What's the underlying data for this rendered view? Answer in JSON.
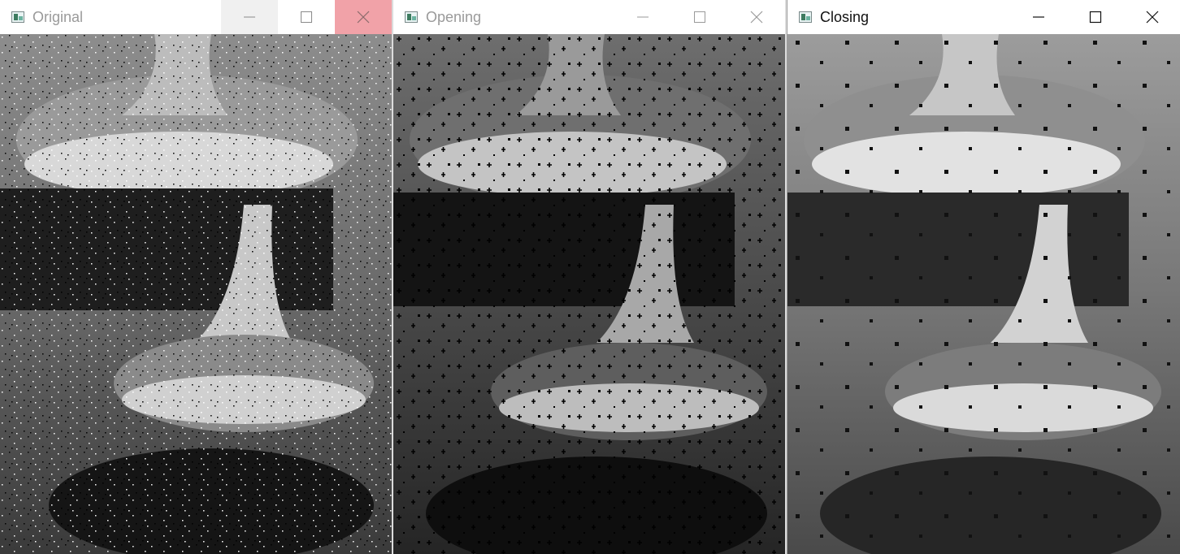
{
  "windows": [
    {
      "title": "Original",
      "state": "inactive",
      "close_hover": true
    },
    {
      "title": "Opening",
      "state": "inactive",
      "close_hover": false
    },
    {
      "title": "Closing",
      "state": "active",
      "close_hover": false
    }
  ],
  "colors": {
    "titlebar_bg": "#ffffff",
    "close_hover_bg": "#f1a2a8",
    "min_hover_bg": "#f0f0f0",
    "inactive_text": "#9a9a9a",
    "active_text": "#111111"
  },
  "icons": {
    "app": "app-window-icon",
    "minimize": "minimize-icon",
    "maximize": "maximize-icon",
    "close": "close-icon"
  }
}
